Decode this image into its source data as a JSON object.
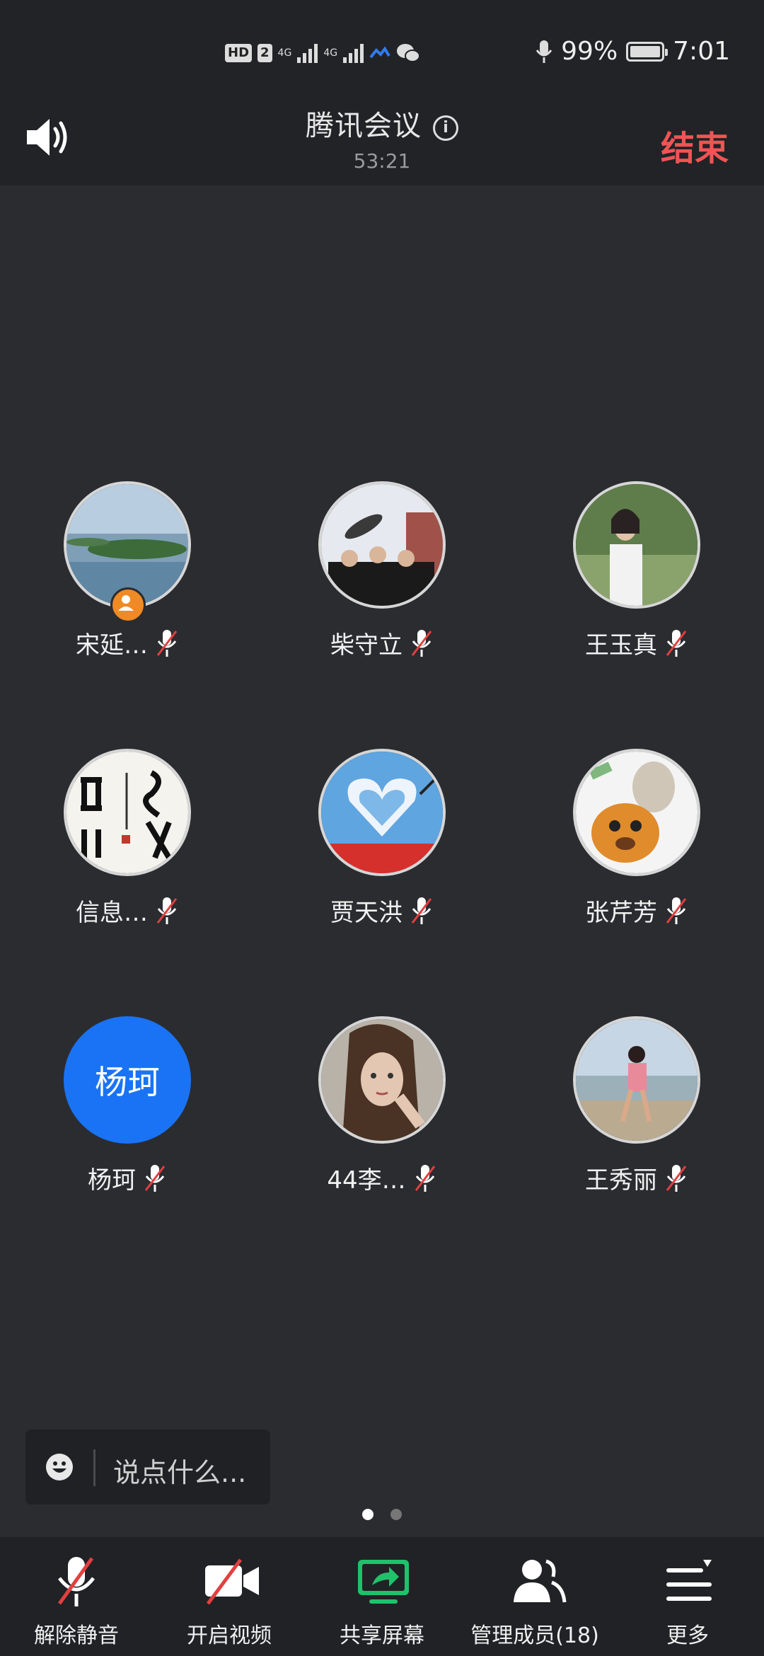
{
  "status": {
    "hd": "HD",
    "sim": "2",
    "net1": "4G",
    "net2": "4G",
    "battery": "99%",
    "time": "7:01"
  },
  "header": {
    "title": "腾讯会议",
    "timer": "53:21",
    "end_label": "结束"
  },
  "participants": [
    {
      "name": "宋延…",
      "avatar": "photo-lake"
    },
    {
      "name": "柴守立",
      "avatar": "photo-graduation"
    },
    {
      "name": "王玉真",
      "avatar": "photo-woman-outdoors"
    },
    {
      "name": "信息…",
      "avatar": "photo-calligraphy"
    },
    {
      "name": "贾天洪",
      "avatar": "photo-heart-cloud"
    },
    {
      "name": "张芹芳",
      "avatar": "photo-cartoon-tiger"
    },
    {
      "name": "杨珂",
      "avatar_text": "杨珂",
      "avatar_color": "#1a73f5"
    },
    {
      "name": "44李…",
      "avatar": "photo-woman-portrait"
    },
    {
      "name": "王秀丽",
      "avatar": "photo-girl-beach"
    }
  ],
  "chat": {
    "placeholder": "说点什么..."
  },
  "pager": {
    "pages": 2,
    "current": 1
  },
  "toolbar": {
    "unmute": "解除静音",
    "video": "开启视频",
    "share": "共享屏幕",
    "members": "管理成员(18)",
    "more": "更多"
  },
  "colors": {
    "end": "#f05454",
    "share": "#1fc26a",
    "avatar_blue": "#1a73f5",
    "host_badge": "#f08a24",
    "muted_slash": "#e24040"
  }
}
